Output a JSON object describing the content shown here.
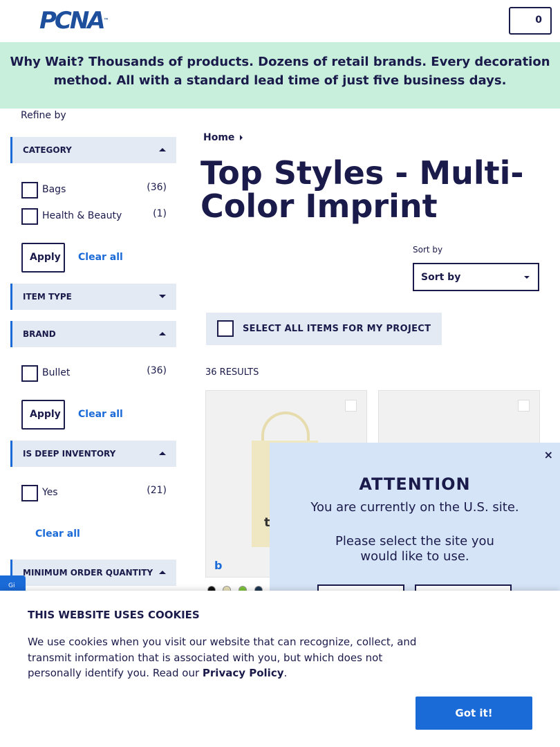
{
  "header": {
    "logo_text": "PCNA",
    "logo_tm": "™",
    "cart_count": "0"
  },
  "banner": {
    "text": "Why Wait? Thousands of products. Dozens of retail brands. Every decoration method. All with a standard lead time of just five business days."
  },
  "sidebar": {
    "refine_label": "Refine by",
    "category": {
      "title": "CATEGORY",
      "options": [
        {
          "label": "Bags",
          "count": "(36)"
        },
        {
          "label": "Health & Beauty",
          "count": "(1)"
        }
      ],
      "apply": "Apply",
      "clear": "Clear all"
    },
    "item_type": {
      "title": "ITEM TYPE"
    },
    "brand": {
      "title": "BRAND",
      "options": [
        {
          "label": "Bullet",
          "count": "(36)"
        }
      ],
      "apply": "Apply",
      "clear": "Clear all"
    },
    "deep_inventory": {
      "title": "IS DEEP INVENTORY",
      "options": [
        {
          "label": "Yes",
          "count": "(21)"
        }
      ],
      "clear": "Clear all"
    },
    "min_order": {
      "title": "MINIMUM ORDER QUANTITY"
    }
  },
  "main": {
    "breadcrumb": "Home",
    "title": "Top Styles - Multi-Color Imprint",
    "sort_label": "Sort by",
    "sort_value": "Sort by",
    "select_all": "SELECT ALL ITEMS FOR MY PROJECT",
    "results": "36 RESULTS",
    "product_imprint_text": "t",
    "swatch_colors": [
      "#111111",
      "#e8dfb8",
      "#7cc23a",
      "#1c3550"
    ]
  },
  "attention": {
    "close": "×",
    "title": "ATTENTION",
    "line1": "You are currently on the U.S. site.",
    "line2": "Please select the site you would like to use."
  },
  "cookie": {
    "title": "THIS WEBSITE USES COOKIES",
    "body": "We use cookies when you visit our website that can recognize, collect, and transmit information that is associated with you, but which does not personally identify you. Read our ",
    "link": "Privacy Policy",
    "period": ".",
    "button": "Got it!"
  },
  "side_tab": "Gi"
}
